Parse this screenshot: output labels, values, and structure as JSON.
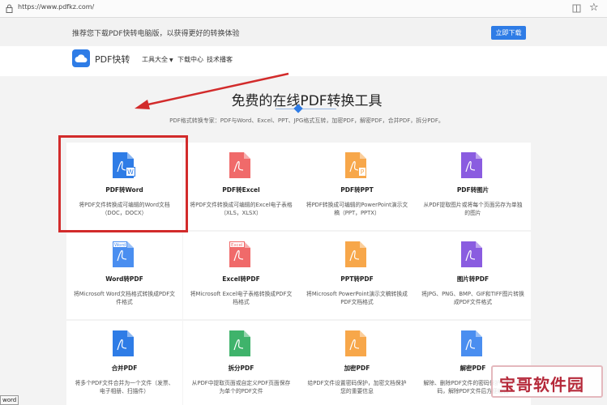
{
  "browser": {
    "url": "https://www.pdfkz.com/",
    "star_glyph": "☆"
  },
  "promo": {
    "text": "推荐您下载PDF快转电脑版，以获得更好的转换体验",
    "button": "立即下载"
  },
  "header": {
    "logo_text": "PDF快转",
    "nav": [
      "工具大全",
      "下载中心",
      "技术播客"
    ]
  },
  "hero": {
    "title": "免费的在线PDF转换工具",
    "subtitle": "PDF格式转换专家：PDF与Word、Excel、PPT、JPG格式互转，加密PDF，解密PDF，合并PDF，拆分PDF。"
  },
  "tools": [
    {
      "title": "PDF转Word",
      "desc": "将PDF文件转换成可编辑的Word文档（DOC，DOCX）",
      "color": "#2e7ce6",
      "badge": "W",
      "icon": "pdf-to-word-icon"
    },
    {
      "title": "PDF转Excel",
      "desc": "将PDF文件转换成可编辑的Excel电子表格（XLS，XLSX）",
      "color": "#f06a6a",
      "badge": "",
      "icon": "pdf-to-excel-icon"
    },
    {
      "title": "PDF转PPT",
      "desc": "将PDF转换成可编辑的PowerPoint演示文稿（PPT，PPTX）",
      "color": "#f7a74a",
      "badge": "P",
      "icon": "pdf-to-ppt-icon"
    },
    {
      "title": "PDF转图片",
      "desc": "从PDF提取图片或将每个页面另存为单独的图片",
      "color": "#8a5ce0",
      "badge": "",
      "icon": "pdf-to-image-icon"
    },
    {
      "title": "Word转PDF",
      "desc": "将Microsoft Word文档格式转换成PDF文件格式",
      "color": "#4a8ef0",
      "badge": "Word",
      "icon": "word-to-pdf-icon"
    },
    {
      "title": "Excel转PDF",
      "desc": "将Microsoft Excel电子表格转换成PDF文档格式",
      "color": "#f06a6a",
      "badge": "Excel",
      "icon": "excel-to-pdf-icon"
    },
    {
      "title": "PPT转PDF",
      "desc": "将Microsoft PowerPoint演示文稿转换成PDF文档格式",
      "color": "#f7a74a",
      "badge": "",
      "icon": "ppt-to-pdf-icon"
    },
    {
      "title": "图片转PDF",
      "desc": "将JPG、PNG、BMP、GIF和TIFF图片转换成PDF文件格式",
      "color": "#8a5ce0",
      "badge": "",
      "icon": "image-to-pdf-icon"
    },
    {
      "title": "合并PDF",
      "desc": "将多个PDF文件合并为一个文件（发票、电子相册、扫描件）",
      "color": "#2e7ce6",
      "badge": "",
      "icon": "merge-pdf-icon"
    },
    {
      "title": "拆分PDF",
      "desc": "从PDF中提取页面或自定义PDF页面保存为单个的PDF文件",
      "color": "#3fb36b",
      "badge": "",
      "icon": "split-pdf-icon"
    },
    {
      "title": "加密PDF",
      "desc": "给PDF文件设置密码保护，加密文档保护您的重要信息",
      "color": "#f7a74a",
      "badge": "",
      "icon": "encrypt-pdf-icon"
    },
    {
      "title": "解密PDF",
      "desc": "解除、删除PDF文件的密码保护，解除密码，解除PDF文件后方便编辑",
      "color": "#4a8ef0",
      "badge": "",
      "icon": "decrypt-pdf-icon"
    }
  ],
  "watermark": "宝哥软件园",
  "status_tooltip": "word"
}
